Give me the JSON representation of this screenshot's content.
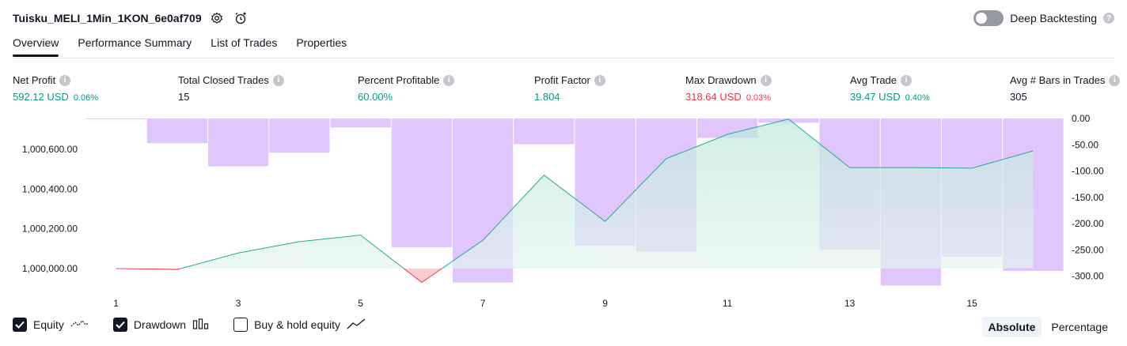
{
  "header": {
    "title": "Tuisku_MELI_1Min_1KON_6e0af709",
    "deep_backtesting_label": "Deep Backtesting"
  },
  "tabs": [
    {
      "label": "Overview",
      "active": true
    },
    {
      "label": "Performance Summary",
      "active": false
    },
    {
      "label": "List of Trades",
      "active": false
    },
    {
      "label": "Properties",
      "active": false
    }
  ],
  "metrics": {
    "net_profit": {
      "label": "Net Profit",
      "value": "592.12 USD",
      "pct": "0.06%"
    },
    "total_closed_trades": {
      "label": "Total Closed Trades",
      "value": "15"
    },
    "percent_profitable": {
      "label": "Percent Profitable",
      "value": "60.00%"
    },
    "profit_factor": {
      "label": "Profit Factor",
      "value": "1.804"
    },
    "max_drawdown": {
      "label": "Max Drawdown",
      "value": "318.64 USD",
      "pct": "0.03%"
    },
    "avg_trade": {
      "label": "Avg Trade",
      "value": "39.47 USD",
      "pct": "0.40%"
    },
    "avg_bars": {
      "label": "Avg # Bars in Trades",
      "value": "305"
    }
  },
  "colors": {
    "green": "#089981",
    "red": "#f23645",
    "equity_line": "#22ab94",
    "equity_fill": "#c8ebe2",
    "drawdown_bar": "#e1c5fd",
    "overlap_line": "#3b7fc0"
  },
  "legend": {
    "equity": {
      "label": "Equity",
      "checked": true,
      "icon": "equity-line-icon"
    },
    "drawdown": {
      "label": "Drawdown",
      "checked": true,
      "icon": "bars-icon"
    },
    "buy_hold": {
      "label": "Buy & hold equity",
      "checked": false,
      "icon": "line-chart-icon"
    }
  },
  "modes": {
    "absolute": "Absolute",
    "percentage": "Percentage",
    "active": "absolute"
  },
  "chart_data": {
    "type": "line",
    "x_ticks": [
      "1",
      "3",
      "5",
      "7",
      "9",
      "11",
      "13",
      "15"
    ],
    "left_axis": {
      "ticks": [
        "1,000,600.00",
        "1,000,400.00",
        "1,000,200.00",
        "1,000,000.00"
      ],
      "tick_values": [
        1000600,
        1000400,
        1000200,
        1000000
      ],
      "range": [
        999920,
        1000755
      ]
    },
    "right_axis": {
      "ticks": [
        "0.00",
        "-50.00",
        "-100.00",
        "-150.00",
        "-200.00",
        "-250.00",
        "-300.00"
      ],
      "tick_values": [
        0,
        -50,
        -100,
        -150,
        -200,
        -250,
        -300
      ],
      "range": [
        -315,
        0
      ]
    },
    "series": [
      {
        "name": "Equity",
        "axis": "left",
        "x": [
          1,
          2,
          3,
          4,
          5,
          6,
          7,
          8,
          9,
          10,
          11,
          12,
          13,
          14,
          15,
          16
        ],
        "values": [
          1000000,
          999995,
          1000078,
          1000135,
          1000168,
          999930,
          1000142,
          1000470,
          1000237,
          1000553,
          1000675,
          1000752,
          1000508,
          1000508,
          1000505,
          1000592
        ]
      },
      {
        "name": "Drawdown",
        "axis": "right",
        "type": "bar",
        "x": [
          1,
          2,
          3,
          4,
          5,
          6,
          7,
          8,
          9,
          10,
          11,
          12,
          13,
          14,
          15,
          16
        ],
        "values": [
          -1,
          -47,
          -91,
          -65,
          -17,
          -245,
          -312,
          -49,
          -242,
          -253,
          -37,
          -8,
          -250,
          -318,
          -263,
          -290
        ]
      }
    ]
  }
}
